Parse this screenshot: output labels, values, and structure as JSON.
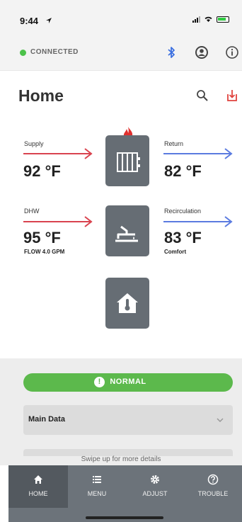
{
  "status_bar": {
    "time": "9:44"
  },
  "connection": {
    "status": "CONNECTED",
    "color": "#4cc24a"
  },
  "header": {
    "title": "Home"
  },
  "readings": {
    "supply": {
      "label": "Supply",
      "value": "92 °F"
    },
    "return": {
      "label": "Return",
      "value": "82 °F"
    },
    "dhw": {
      "label": "DHW",
      "value": "95 °F",
      "sub": "FLOW 4.0 GPM"
    },
    "recirculation": {
      "label": "Recirculation",
      "value": "83 °F",
      "sub": "Comfort"
    }
  },
  "colors": {
    "hot": "#d9434f",
    "cold": "#5b7be0",
    "tile": "#666d74",
    "ok": "#5cb94c"
  },
  "status": {
    "label": "NORMAL"
  },
  "main_data": {
    "label": "Main Data"
  },
  "swipe_hint": "Swipe up for more details",
  "nav": {
    "items": [
      {
        "label": "HOME",
        "icon": "home-icon"
      },
      {
        "label": "MENU",
        "icon": "list-icon"
      },
      {
        "label": "ADJUST",
        "icon": "gear-icon"
      },
      {
        "label": "TROUBLE",
        "icon": "help-icon"
      }
    ]
  }
}
